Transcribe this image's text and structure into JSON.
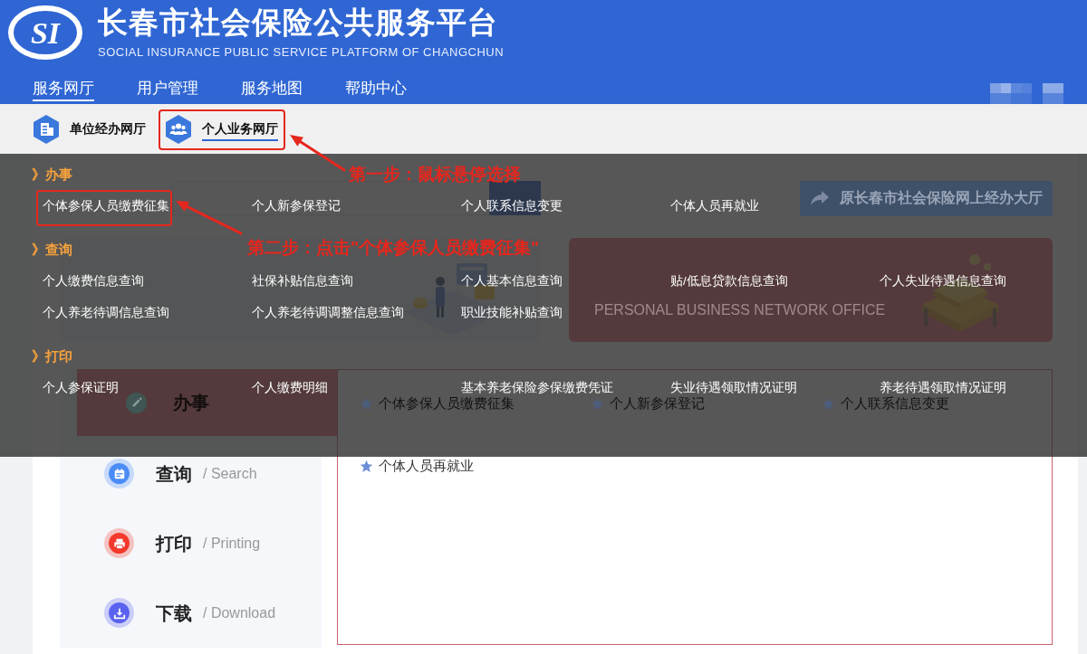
{
  "header": {
    "logo_text": "SI",
    "title": "长春市社会保险公共服务平台",
    "subtitle": "SOCIAL INSURANCE PUBLIC SERVICE PLATFORM OF CHANGCHUN",
    "nav": [
      {
        "label": "服务网厅",
        "selected": true
      },
      {
        "label": "用户管理",
        "selected": false
      },
      {
        "label": "服务地图",
        "selected": false
      },
      {
        "label": "帮助中心",
        "selected": false
      }
    ]
  },
  "halls": [
    {
      "kind": "building",
      "label": "单位经办网厅",
      "selected": false
    },
    {
      "kind": "people",
      "label": "个人业务网厅",
      "selected": true
    }
  ],
  "legacy_link": "原长春市社会保险网上经办大厅",
  "portal_cards": [
    {
      "kind": "unit"
    },
    {
      "kind": "personal",
      "subtitle": "PERSONAL BUSINESS NETWORK OFFICE"
    }
  ],
  "categories": [
    {
      "kind": "pencil",
      "label": "办事",
      "color": "#3f5654",
      "selected": true
    },
    {
      "kind": "document",
      "label": "查询",
      "english": "/ Search",
      "color": "#4a8cf5",
      "selected": false
    },
    {
      "kind": "printer",
      "label": "打印",
      "english": "/ Printing",
      "color": "#f2392c",
      "selected": false
    },
    {
      "kind": "download",
      "label": "下载",
      "english": "/ Download",
      "color": "#5a62ef",
      "selected": false
    }
  ],
  "services": [
    "个体参保人员缴费征集",
    "个人新参保登记",
    "个人联系信息变更",
    "个体人员再就业"
  ],
  "mega_menu": {
    "sections": [
      {
        "title": "》办事",
        "items": [
          "个体参保人员缴费征集",
          "个人新参保登记",
          "个人联系信息变更",
          "个体人员再就业"
        ]
      },
      {
        "title": "》查询",
        "items": [
          "个人缴费信息查询",
          "社保补贴信息查询",
          "个人基本信息查询",
          "贴/低息贷款信息查询",
          "个人失业待遇信息查询",
          "个人养老待调信息查询",
          "个人养老待调调整信息查询",
          "职业技能补贴查询"
        ]
      },
      {
        "title": "》打印",
        "items": [
          "个人参保证明",
          "个人缴费明细",
          "基本养老保险参保缴费凭证",
          "失业待遇领取情况证明",
          "养老待遇领取情况证明"
        ]
      }
    ]
  },
  "annotations": [
    {
      "text": "第一步：鼠标悬停选择"
    },
    {
      "text": "第二步：点击\"个体参保人员缴费征集\""
    }
  ]
}
